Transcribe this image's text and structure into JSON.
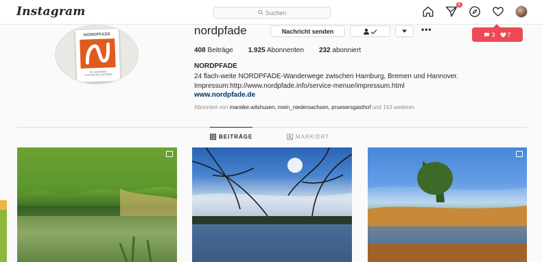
{
  "app": {
    "logo_text": "Instagram"
  },
  "search": {
    "placeholder": "Suchen"
  },
  "nav": {
    "direct_badge": "2",
    "icons": [
      "home-icon",
      "direct-icon",
      "explore-icon",
      "heart-icon",
      "profile-avatar"
    ]
  },
  "notification": {
    "comments": "3",
    "likes": "7",
    "color": "#ed4956"
  },
  "profile": {
    "card_title": "NORDPFADE",
    "card_subtitle_line1": "IM LANDKREIS",
    "card_subtitle_line2": "ROTENBURG (WÜMME)",
    "username": "nordpfade",
    "message_button": "Nachricht senden",
    "follow_button_icon": "person-check-icon",
    "caret_icon": "caret-down-icon",
    "more_icon": "•••",
    "stats": [
      {
        "count": "408",
        "label": "Beiträge"
      },
      {
        "count": "1.925",
        "label": "Abonnenten"
      },
      {
        "count": "232",
        "label": "abonniert"
      }
    ],
    "full_name": "NORDPFADE",
    "bio_line1": "24 flach-weite NORDPFADE-Wanderwege zwischen Hamburg, Bremen und Hannover.",
    "bio_line2": "Impressum:http://www.nordpfade.info/service-menue/impressum.html",
    "website": "www.nordpfade.de",
    "followed_prefix": "Abonniert von",
    "followed_names": "mareike.wilshusen, mein_niedersachsen, pruesersgasthof",
    "followed_suffix": "und 163 weiteren"
  },
  "tabs": [
    {
      "label": "BEITRÄGE",
      "active": true,
      "icon": "grid-icon"
    },
    {
      "label": "MARKIERT",
      "active": false,
      "icon": "tagged-icon"
    }
  ],
  "posts": [
    {
      "name": "post-lake-forest",
      "multi": true
    },
    {
      "name": "post-sun-branches",
      "multi": false
    },
    {
      "name": "post-heath-pond",
      "multi": true
    }
  ]
}
